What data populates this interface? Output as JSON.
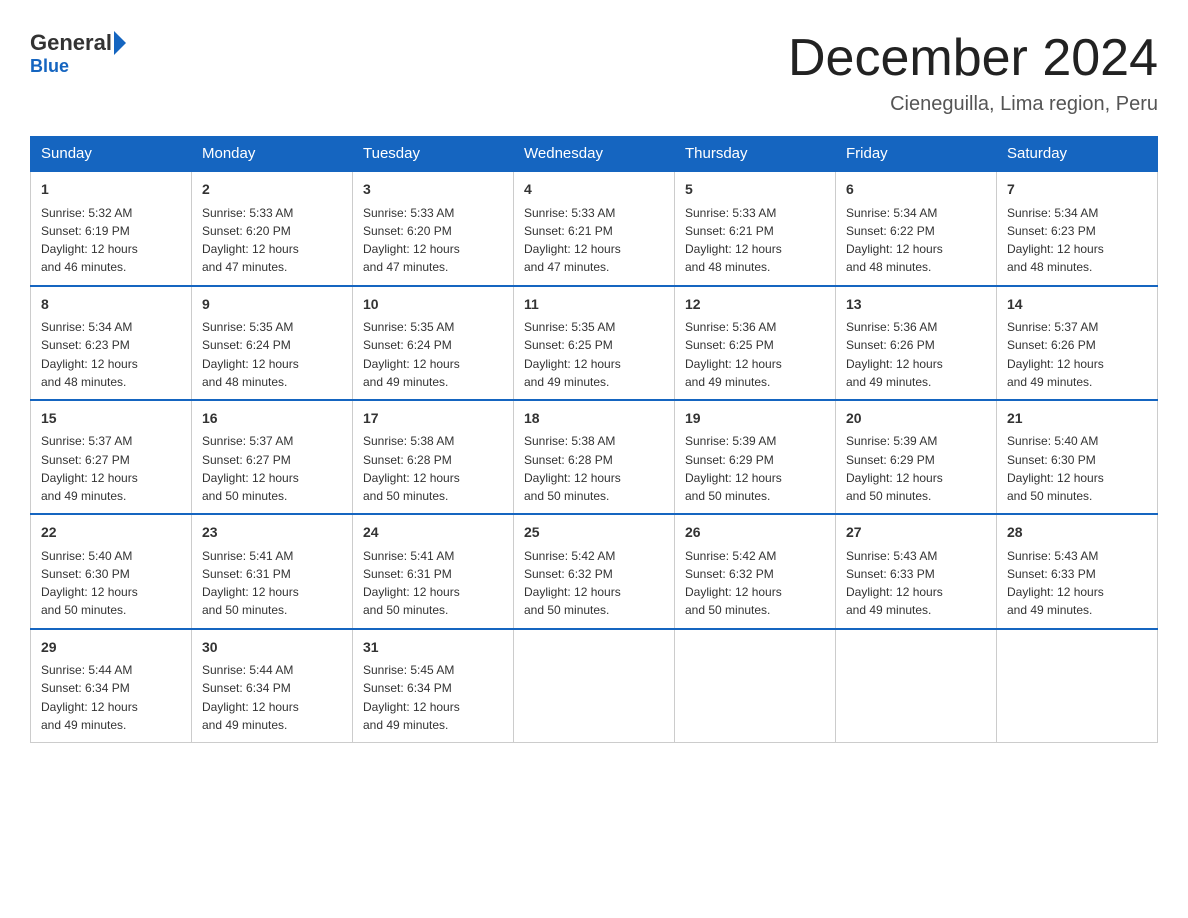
{
  "logo": {
    "general": "General",
    "blue": "Blue"
  },
  "title": "December 2024",
  "subtitle": "Cieneguilla, Lima region, Peru",
  "days_of_week": [
    "Sunday",
    "Monday",
    "Tuesday",
    "Wednesday",
    "Thursday",
    "Friday",
    "Saturday"
  ],
  "weeks": [
    [
      {
        "day": "1",
        "sunrise": "5:32 AM",
        "sunset": "6:19 PM",
        "daylight": "12 hours and 46 minutes."
      },
      {
        "day": "2",
        "sunrise": "5:33 AM",
        "sunset": "6:20 PM",
        "daylight": "12 hours and 47 minutes."
      },
      {
        "day": "3",
        "sunrise": "5:33 AM",
        "sunset": "6:20 PM",
        "daylight": "12 hours and 47 minutes."
      },
      {
        "day": "4",
        "sunrise": "5:33 AM",
        "sunset": "6:21 PM",
        "daylight": "12 hours and 47 minutes."
      },
      {
        "day": "5",
        "sunrise": "5:33 AM",
        "sunset": "6:21 PM",
        "daylight": "12 hours and 48 minutes."
      },
      {
        "day": "6",
        "sunrise": "5:34 AM",
        "sunset": "6:22 PM",
        "daylight": "12 hours and 48 minutes."
      },
      {
        "day": "7",
        "sunrise": "5:34 AM",
        "sunset": "6:23 PM",
        "daylight": "12 hours and 48 minutes."
      }
    ],
    [
      {
        "day": "8",
        "sunrise": "5:34 AM",
        "sunset": "6:23 PM",
        "daylight": "12 hours and 48 minutes."
      },
      {
        "day": "9",
        "sunrise": "5:35 AM",
        "sunset": "6:24 PM",
        "daylight": "12 hours and 48 minutes."
      },
      {
        "day": "10",
        "sunrise": "5:35 AM",
        "sunset": "6:24 PM",
        "daylight": "12 hours and 49 minutes."
      },
      {
        "day": "11",
        "sunrise": "5:35 AM",
        "sunset": "6:25 PM",
        "daylight": "12 hours and 49 minutes."
      },
      {
        "day": "12",
        "sunrise": "5:36 AM",
        "sunset": "6:25 PM",
        "daylight": "12 hours and 49 minutes."
      },
      {
        "day": "13",
        "sunrise": "5:36 AM",
        "sunset": "6:26 PM",
        "daylight": "12 hours and 49 minutes."
      },
      {
        "day": "14",
        "sunrise": "5:37 AM",
        "sunset": "6:26 PM",
        "daylight": "12 hours and 49 minutes."
      }
    ],
    [
      {
        "day": "15",
        "sunrise": "5:37 AM",
        "sunset": "6:27 PM",
        "daylight": "12 hours and 49 minutes."
      },
      {
        "day": "16",
        "sunrise": "5:37 AM",
        "sunset": "6:27 PM",
        "daylight": "12 hours and 50 minutes."
      },
      {
        "day": "17",
        "sunrise": "5:38 AM",
        "sunset": "6:28 PM",
        "daylight": "12 hours and 50 minutes."
      },
      {
        "day": "18",
        "sunrise": "5:38 AM",
        "sunset": "6:28 PM",
        "daylight": "12 hours and 50 minutes."
      },
      {
        "day": "19",
        "sunrise": "5:39 AM",
        "sunset": "6:29 PM",
        "daylight": "12 hours and 50 minutes."
      },
      {
        "day": "20",
        "sunrise": "5:39 AM",
        "sunset": "6:29 PM",
        "daylight": "12 hours and 50 minutes."
      },
      {
        "day": "21",
        "sunrise": "5:40 AM",
        "sunset": "6:30 PM",
        "daylight": "12 hours and 50 minutes."
      }
    ],
    [
      {
        "day": "22",
        "sunrise": "5:40 AM",
        "sunset": "6:30 PM",
        "daylight": "12 hours and 50 minutes."
      },
      {
        "day": "23",
        "sunrise": "5:41 AM",
        "sunset": "6:31 PM",
        "daylight": "12 hours and 50 minutes."
      },
      {
        "day": "24",
        "sunrise": "5:41 AM",
        "sunset": "6:31 PM",
        "daylight": "12 hours and 50 minutes."
      },
      {
        "day": "25",
        "sunrise": "5:42 AM",
        "sunset": "6:32 PM",
        "daylight": "12 hours and 50 minutes."
      },
      {
        "day": "26",
        "sunrise": "5:42 AM",
        "sunset": "6:32 PM",
        "daylight": "12 hours and 50 minutes."
      },
      {
        "day": "27",
        "sunrise": "5:43 AM",
        "sunset": "6:33 PM",
        "daylight": "12 hours and 49 minutes."
      },
      {
        "day": "28",
        "sunrise": "5:43 AM",
        "sunset": "6:33 PM",
        "daylight": "12 hours and 49 minutes."
      }
    ],
    [
      {
        "day": "29",
        "sunrise": "5:44 AM",
        "sunset": "6:34 PM",
        "daylight": "12 hours and 49 minutes."
      },
      {
        "day": "30",
        "sunrise": "5:44 AM",
        "sunset": "6:34 PM",
        "daylight": "12 hours and 49 minutes."
      },
      {
        "day": "31",
        "sunrise": "5:45 AM",
        "sunset": "6:34 PM",
        "daylight": "12 hours and 49 minutes."
      },
      null,
      null,
      null,
      null
    ]
  ],
  "labels": {
    "sunrise": "Sunrise:",
    "sunset": "Sunset:",
    "daylight": "Daylight:"
  }
}
